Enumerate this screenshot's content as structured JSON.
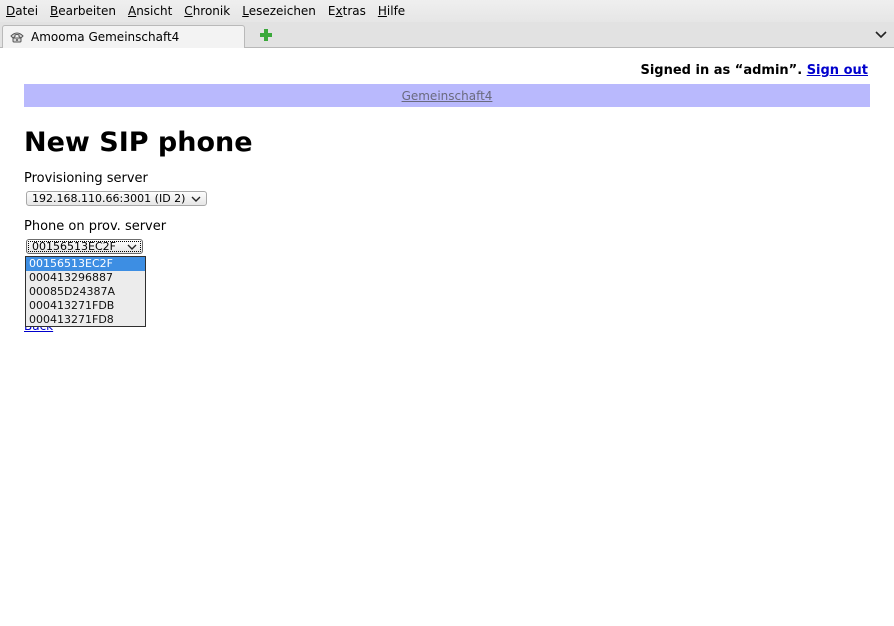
{
  "browser": {
    "menu": [
      {
        "pre": "",
        "key": "D",
        "post": "atei"
      },
      {
        "pre": "",
        "key": "B",
        "post": "earbeiten"
      },
      {
        "pre": "",
        "key": "A",
        "post": "nsicht"
      },
      {
        "pre": "",
        "key": "C",
        "post": "hronik"
      },
      {
        "pre": "",
        "key": "L",
        "post": "esezeichen"
      },
      {
        "pre": "E",
        "key": "x",
        "post": "tras"
      },
      {
        "pre": "",
        "key": "H",
        "post": "ilfe"
      }
    ],
    "tab_title": "Amooma Gemeinschaft4",
    "icons": {
      "tab_favicon": "phone-icon",
      "new_tab": "plus-icon",
      "tab_list": "chevron-down-icon"
    },
    "colors": {
      "new_tab_plus": "#3aa83a"
    }
  },
  "page": {
    "signed_in_prefix": "Signed in as “admin”. ",
    "sign_out": "Sign out",
    "tenant_link": "Gemeinschaft4",
    "heading": "New SIP phone",
    "provisioning_label": "Provisioning server",
    "provisioning_value": "192.168.110.66:3001 (ID 2)",
    "phone_label": "Phone on prov. server",
    "phone_value": "00156513EC2F",
    "phone_options": [
      "00156513EC2F",
      "000413296887",
      "00085D24387A",
      "000413271FDB",
      "000413271FD8"
    ],
    "selected_option_index": 0,
    "back_link": "Back",
    "colors": {
      "tenant_bar": "#b9b9fd",
      "link": "#0000cc",
      "option_highlight": "#3d8ee3"
    }
  }
}
